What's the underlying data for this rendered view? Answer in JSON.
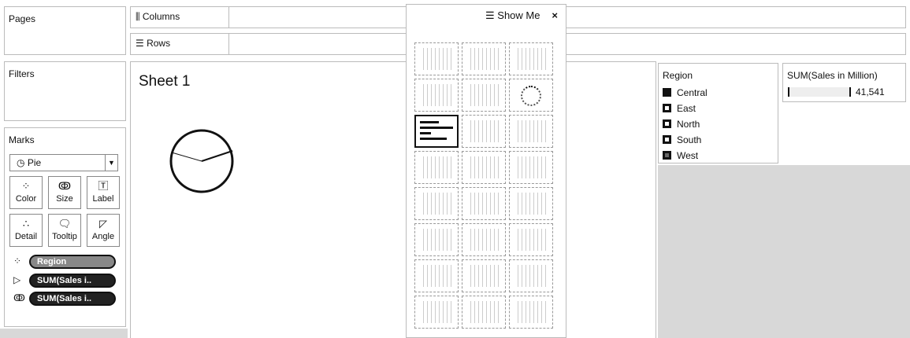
{
  "left": {
    "pages_title": "Pages",
    "filters_title": "Filters",
    "marks_title": "Marks"
  },
  "shelves": {
    "columns": "Columns",
    "rows": "Rows",
    "columns_icon": "columns-icon",
    "rows_icon": "rows-icon"
  },
  "marks": {
    "type": "Pie",
    "type_icon": "pie-clock-icon",
    "buttons": [
      {
        "label": "Color",
        "icon": "color-dots-icon"
      },
      {
        "label": "Size",
        "icon": "size-icon"
      },
      {
        "label": "Label",
        "icon": "label-T-icon"
      },
      {
        "label": "Detail",
        "icon": "detail-icon"
      },
      {
        "label": "Tooltip",
        "icon": "tooltip-icon"
      },
      {
        "label": "Angle",
        "icon": "angle-icon"
      }
    ],
    "fields": [
      {
        "label": "Region",
        "icon": "color-dots-icon"
      },
      {
        "label": "SUM(Sales i..",
        "icon": "angle-icon"
      },
      {
        "label": "SUM(Sales i..",
        "icon": "size-icon"
      }
    ]
  },
  "sheet": {
    "title": "Sheet 1",
    "pie_region_count": 5
  },
  "showme": {
    "title": "Show Me",
    "close": "×",
    "selected_index": 6,
    "charts": [
      "text-table",
      "heat-map",
      "highlight-table",
      "symbol-map",
      "filled-map",
      "pie",
      "horizontal-bars",
      "stacked-bars",
      "side-by-side-bars",
      "treemap",
      "circle-views",
      "side-by-side-circles",
      "continuous-lines",
      "discrete-lines",
      "dual-lines",
      "continuous-area",
      "discrete-area",
      "dual-combination",
      "scatter-plot",
      "histogram",
      "box-and-whisker",
      "gantt",
      "bullet",
      "packed-bubbles"
    ]
  },
  "region_legend": {
    "title": "Region",
    "items": [
      "Central",
      "East",
      "North",
      "South",
      "West"
    ]
  },
  "size_legend": {
    "title": "SUM(Sales in Million)",
    "max_value": "41,541"
  }
}
